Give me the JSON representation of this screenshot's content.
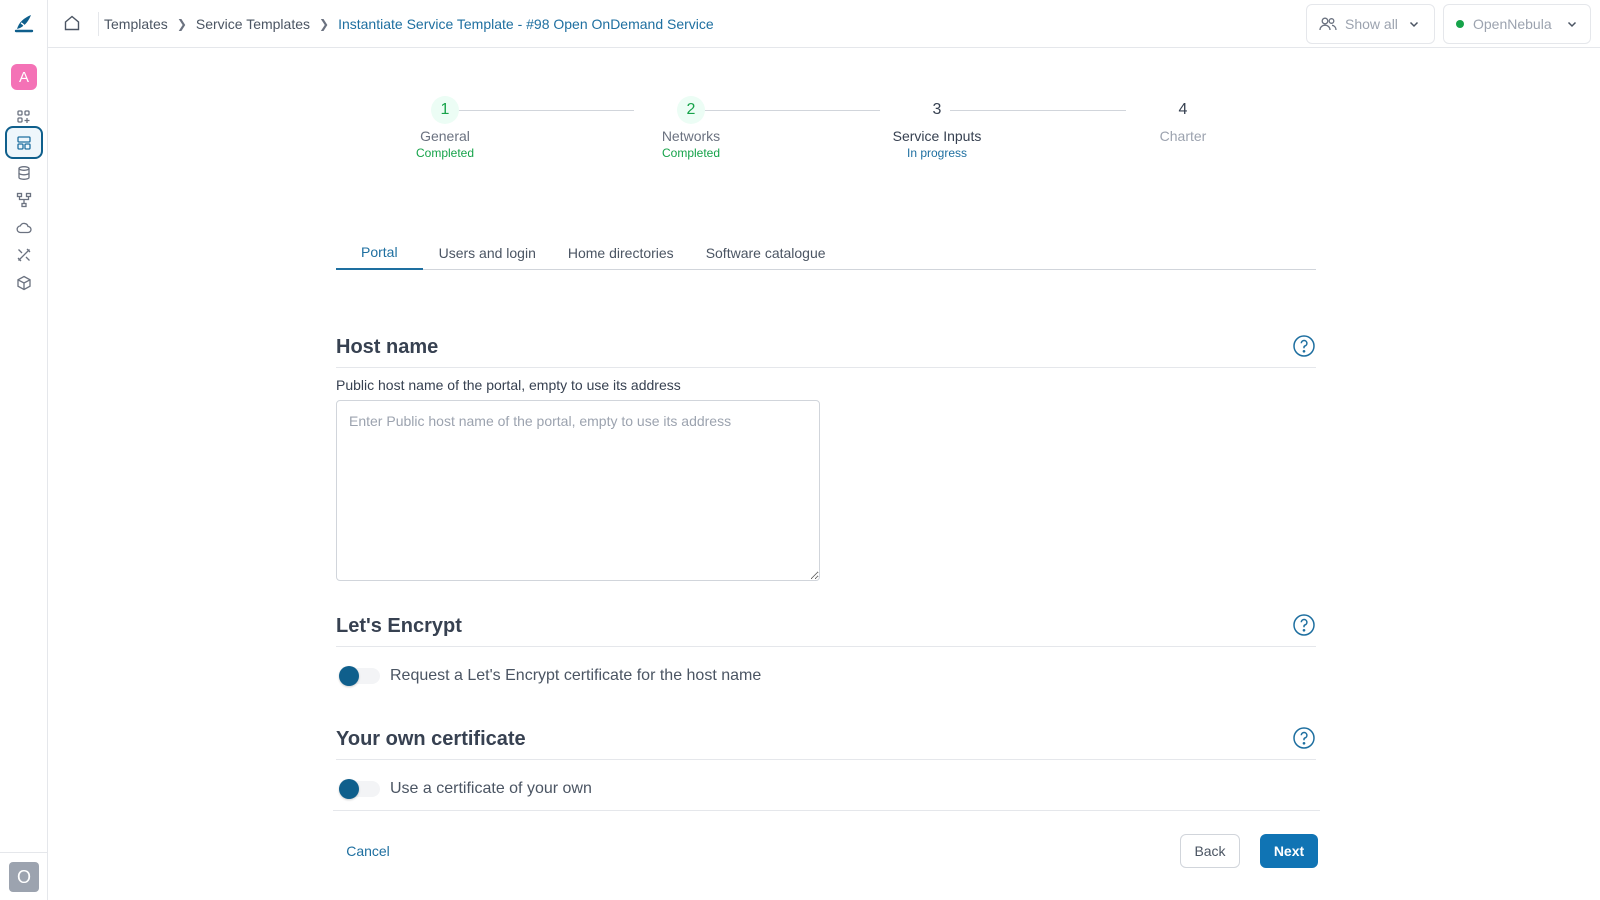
{
  "sidebar": {
    "avatar_top_letter": "A",
    "avatar_bottom_letter": "O",
    "icons": [
      "dashboard-icon",
      "templates-icon",
      "storage-icon",
      "network-icon",
      "cloud-icon",
      "tools-icon",
      "system-icon"
    ]
  },
  "breadcrumb": {
    "items": [
      "Templates",
      "Service Templates"
    ],
    "current": "Instantiate Service Template - #98 Open OnDemand Service"
  },
  "header": {
    "group_filter": "Show all",
    "zone": "OpenNebula"
  },
  "stepper": {
    "steps": [
      {
        "num": "1",
        "label": "General",
        "status": "Completed"
      },
      {
        "num": "2",
        "label": "Networks",
        "status": "Completed"
      },
      {
        "num": "3",
        "label": "Service Inputs",
        "status": "In progress"
      },
      {
        "num": "4",
        "label": "Charter",
        "status": ""
      }
    ]
  },
  "tabs": [
    "Portal",
    "Users and login",
    "Home directories",
    "Software catalogue"
  ],
  "sections": {
    "hostname": {
      "title": "Host name",
      "field_label": "Public host name of the portal, empty to use its address",
      "placeholder": "Enter Public host name of the portal, empty to use its address",
      "value": ""
    },
    "letsencrypt": {
      "title": "Let's Encrypt",
      "toggle_label": "Request a Let's Encrypt certificate for the host name"
    },
    "owncert": {
      "title": "Your own certificate",
      "toggle_label": "Use a certificate of your own"
    }
  },
  "footer": {
    "cancel": "Cancel",
    "back": "Back",
    "next": "Next"
  },
  "colors": {
    "accent": "#1e6fa0",
    "primary_button": "#1074b4",
    "completed": "#16a34a",
    "avatar_pink": "#f472b6"
  }
}
